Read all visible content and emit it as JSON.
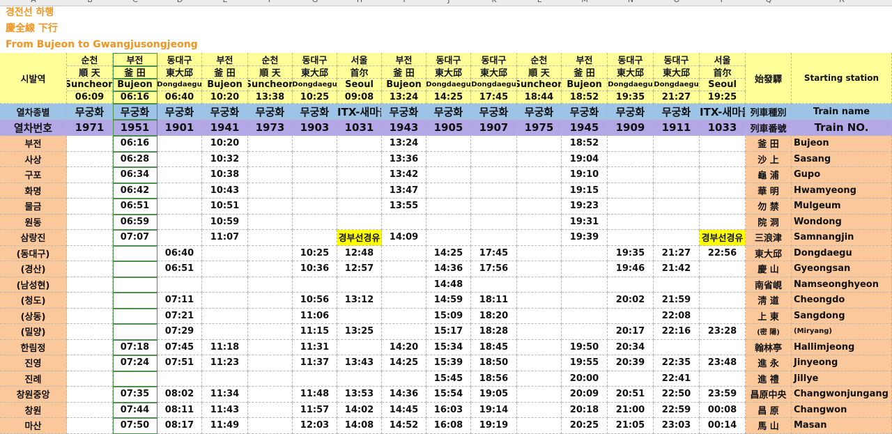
{
  "column_letters": [
    "A",
    "B",
    "C",
    "D",
    "E",
    "F",
    "G",
    "H",
    "I",
    "J",
    "K",
    "L",
    "M",
    "N",
    "O",
    "P",
    "Q",
    "R"
  ],
  "titles": {
    "line1": "경전선 하행",
    "line2": "慶全線 下行",
    "line3": "From Bujeon to Gwangjusongjeong"
  },
  "header": {
    "label_ko": "시발역",
    "label_hanja": "始發驛",
    "label_en": "Starting station",
    "trains": [
      {
        "ko": "순천",
        "hanja": "順 天",
        "en": "Suncheon",
        "time": "06:09"
      },
      {
        "ko": "부전",
        "hanja": "釜 田",
        "en": "Bujeon",
        "time": "06:16"
      },
      {
        "ko": "동대구",
        "hanja": "東大邱",
        "en": "Dongdaegu",
        "time": "06:40"
      },
      {
        "ko": "부전",
        "hanja": "釜 田",
        "en": "Bujeon",
        "time": "10:20"
      },
      {
        "ko": "순천",
        "hanja": "順 天",
        "en": "Suncheon",
        "time": "13:38"
      },
      {
        "ko": "동대구",
        "hanja": "東大邱",
        "en": "Dongdaegu",
        "time": "10:25"
      },
      {
        "ko": "서울",
        "hanja": "首尔",
        "en": "Seoul",
        "time": "09:08"
      },
      {
        "ko": "부전",
        "hanja": "釜 田",
        "en": "Bujeon",
        "time": "13:24"
      },
      {
        "ko": "동대구",
        "hanja": "東大邱",
        "en": "Dongdaegu",
        "time": "14:25"
      },
      {
        "ko": "동대구",
        "hanja": "東大邱",
        "en": "Dongdaegu",
        "time": "17:45"
      },
      {
        "ko": "순천",
        "hanja": "順 天",
        "en": "Suncheon",
        "time": "18:44"
      },
      {
        "ko": "부전",
        "hanja": "釜 田",
        "en": "Bujeon",
        "time": "18:52"
      },
      {
        "ko": "동대구",
        "hanja": "東大邱",
        "en": "Dongdaegu",
        "time": "19:35"
      },
      {
        "ko": "동대구",
        "hanja": "東大邱",
        "en": "Dongdaegu",
        "time": "21:27"
      },
      {
        "ko": "서울",
        "hanja": "首尔",
        "en": "Seoul",
        "time": "19:25"
      }
    ]
  },
  "train_type": {
    "label_ko": "열차종별",
    "label_hanja": "列車種別",
    "label_en": "Train name",
    "values": [
      "무궁화",
      "무궁화",
      "무궁화",
      "무궁화",
      "무궁화",
      "무궁화",
      "ITX-새마을",
      "무궁화",
      "무궁화",
      "무궁화",
      "무궁화",
      "무궁화",
      "무궁화",
      "무궁화",
      "ITX-새마을"
    ]
  },
  "train_no": {
    "label_ko": "열차번호",
    "label_hanja": "列車番號",
    "label_en": "Train NO.",
    "values": [
      "1971",
      "1951",
      "1901",
      "1941",
      "1973",
      "1903",
      "1031",
      "1943",
      "1905",
      "1907",
      "1975",
      "1945",
      "1909",
      "1911",
      "1033"
    ]
  },
  "stations": [
    {
      "ko": "부전",
      "hanja": "釜 田",
      "en": "Bujeon",
      "times": [
        "",
        "06:16",
        "",
        "10:20",
        "",
        "",
        "",
        "13:24",
        "",
        "",
        "",
        "18:52",
        "",
        "",
        ""
      ]
    },
    {
      "ko": "사상",
      "hanja": "沙 上",
      "en": "Sasang",
      "times": [
        "",
        "06:28",
        "",
        "10:32",
        "",
        "",
        "",
        "13:36",
        "",
        "",
        "",
        "19:04",
        "",
        "",
        ""
      ]
    },
    {
      "ko": "구포",
      "hanja": "龜 浦",
      "en": "Gupo",
      "times": [
        "",
        "06:34",
        "",
        "10:38",
        "",
        "",
        "",
        "13:42",
        "",
        "",
        "",
        "19:10",
        "",
        "",
        ""
      ]
    },
    {
      "ko": "화명",
      "hanja": "華 明",
      "en": "Hwamyeong",
      "times": [
        "",
        "06:42",
        "",
        "10:43",
        "",
        "",
        "",
        "13:47",
        "",
        "",
        "",
        "19:15",
        "",
        "",
        ""
      ]
    },
    {
      "ko": "물금",
      "hanja": "勿 禁",
      "en": "Mulgeum",
      "times": [
        "",
        "06:51",
        "",
        "10:51",
        "",
        "",
        "",
        "13:55",
        "",
        "",
        "",
        "19:23",
        "",
        "",
        ""
      ]
    },
    {
      "ko": "원동",
      "hanja": "院 洞",
      "en": "Wondong",
      "times": [
        "",
        "06:59",
        "",
        "10:59",
        "",
        "",
        "",
        "",
        "",
        "",
        "",
        "19:31",
        "",
        "",
        ""
      ]
    },
    {
      "ko": "삼랑진",
      "hanja": "三浪津",
      "en": "Samnangjin",
      "times": [
        "",
        "07:07",
        "",
        "11:07",
        "",
        "",
        "경부선경유",
        "14:09",
        "",
        "",
        "",
        "19:39",
        "",
        "",
        "경부선경유"
      ]
    },
    {
      "ko": "(동대구)",
      "hanja": "東大邱",
      "en": "Dongdaegu",
      "times": [
        "",
        "",
        "06:40",
        "",
        "",
        "10:25",
        "12:48",
        "",
        "14:25",
        "17:45",
        "",
        "",
        "19:35",
        "21:27",
        "22:56"
      ]
    },
    {
      "ko": "(경산)",
      "hanja": "慶 山",
      "en": "Gyeongsan",
      "times": [
        "",
        "",
        "06:51",
        "",
        "",
        "10:36",
        "12:57",
        "",
        "14:36",
        "17:56",
        "",
        "",
        "19:46",
        "21:42",
        ""
      ]
    },
    {
      "ko": "(남성현)",
      "hanja": "南省峴",
      "en": "Namseonghyeon",
      "times": [
        "",
        "",
        "",
        "",
        "",
        "",
        "",
        "",
        "14:48",
        "",
        "",
        "",
        "",
        "",
        ""
      ]
    },
    {
      "ko": "(청도)",
      "hanja": "淸 道",
      "en": "Cheongdo",
      "times": [
        "",
        "",
        "07:11",
        "",
        "",
        "10:56",
        "13:12",
        "",
        "14:59",
        "18:11",
        "",
        "",
        "20:02",
        "21:59",
        ""
      ]
    },
    {
      "ko": "(상동)",
      "hanja": "上 東",
      "en": "Sangdong",
      "times": [
        "",
        "",
        "07:21",
        "",
        "",
        "11:06",
        "",
        "",
        "15:09",
        "18:20",
        "",
        "",
        "",
        "22:08",
        ""
      ]
    },
    {
      "ko": "(밀양)",
      "hanja": "(密 陽)",
      "en": "(Miryang)",
      "times": [
        "",
        "",
        "07:29",
        "",
        "",
        "11:15",
        "13:25",
        "",
        "15:17",
        "18:28",
        "",
        "",
        "20:17",
        "22:16",
        "23:28"
      ]
    },
    {
      "ko": "한림정",
      "hanja": "翰林亭",
      "en": "Hallimjeong",
      "times": [
        "",
        "07:18",
        "07:45",
        "11:18",
        "",
        "11:31",
        "",
        "14:20",
        "15:34",
        "18:45",
        "",
        "19:50",
        "20:34",
        "",
        ""
      ]
    },
    {
      "ko": "진영",
      "hanja": "進 永",
      "en": "Jinyeong",
      "times": [
        "",
        "07:24",
        "07:51",
        "11:23",
        "",
        "11:37",
        "13:43",
        "14:25",
        "15:39",
        "18:50",
        "",
        "19:55",
        "20:39",
        "22:35",
        "23:48"
      ]
    },
    {
      "ko": "진례",
      "hanja": "進 禮",
      "en": "Jillye",
      "times": [
        "",
        "",
        "",
        "",
        "",
        "",
        "",
        "",
        "15:45",
        "18:56",
        "",
        "20:00",
        "",
        "22:41",
        ""
      ]
    },
    {
      "ko": "창원중앙",
      "hanja": "昌原中央",
      "en": "Changwonjungang",
      "times": [
        "",
        "07:35",
        "08:02",
        "11:34",
        "",
        "11:48",
        "13:53",
        "14:36",
        "15:54",
        "19:05",
        "",
        "20:09",
        "20:51",
        "22:50",
        "23:59"
      ]
    },
    {
      "ko": "창원",
      "hanja": "昌 原",
      "en": "Changwon",
      "times": [
        "",
        "07:44",
        "08:11",
        "11:43",
        "",
        "11:57",
        "14:02",
        "14:45",
        "16:03",
        "19:14",
        "",
        "20:18",
        "21:00",
        "22:59",
        "00:08"
      ]
    },
    {
      "ko": "마산",
      "hanja": "馬 山",
      "en": "Masan",
      "times": [
        "",
        "07:50",
        "08:17",
        "11:49",
        "",
        "12:03",
        "14:08",
        "14:52",
        "16:08",
        "19:19",
        "",
        "20:25",
        "21:05",
        "23:03",
        "00:14"
      ]
    }
  ],
  "colors": {
    "orange": "#fac89a",
    "yellow": "#ffff99",
    "blue": "#9dc3e6",
    "purple": "#b4a7e6",
    "title": "#f29421",
    "note": "#ffff00"
  }
}
